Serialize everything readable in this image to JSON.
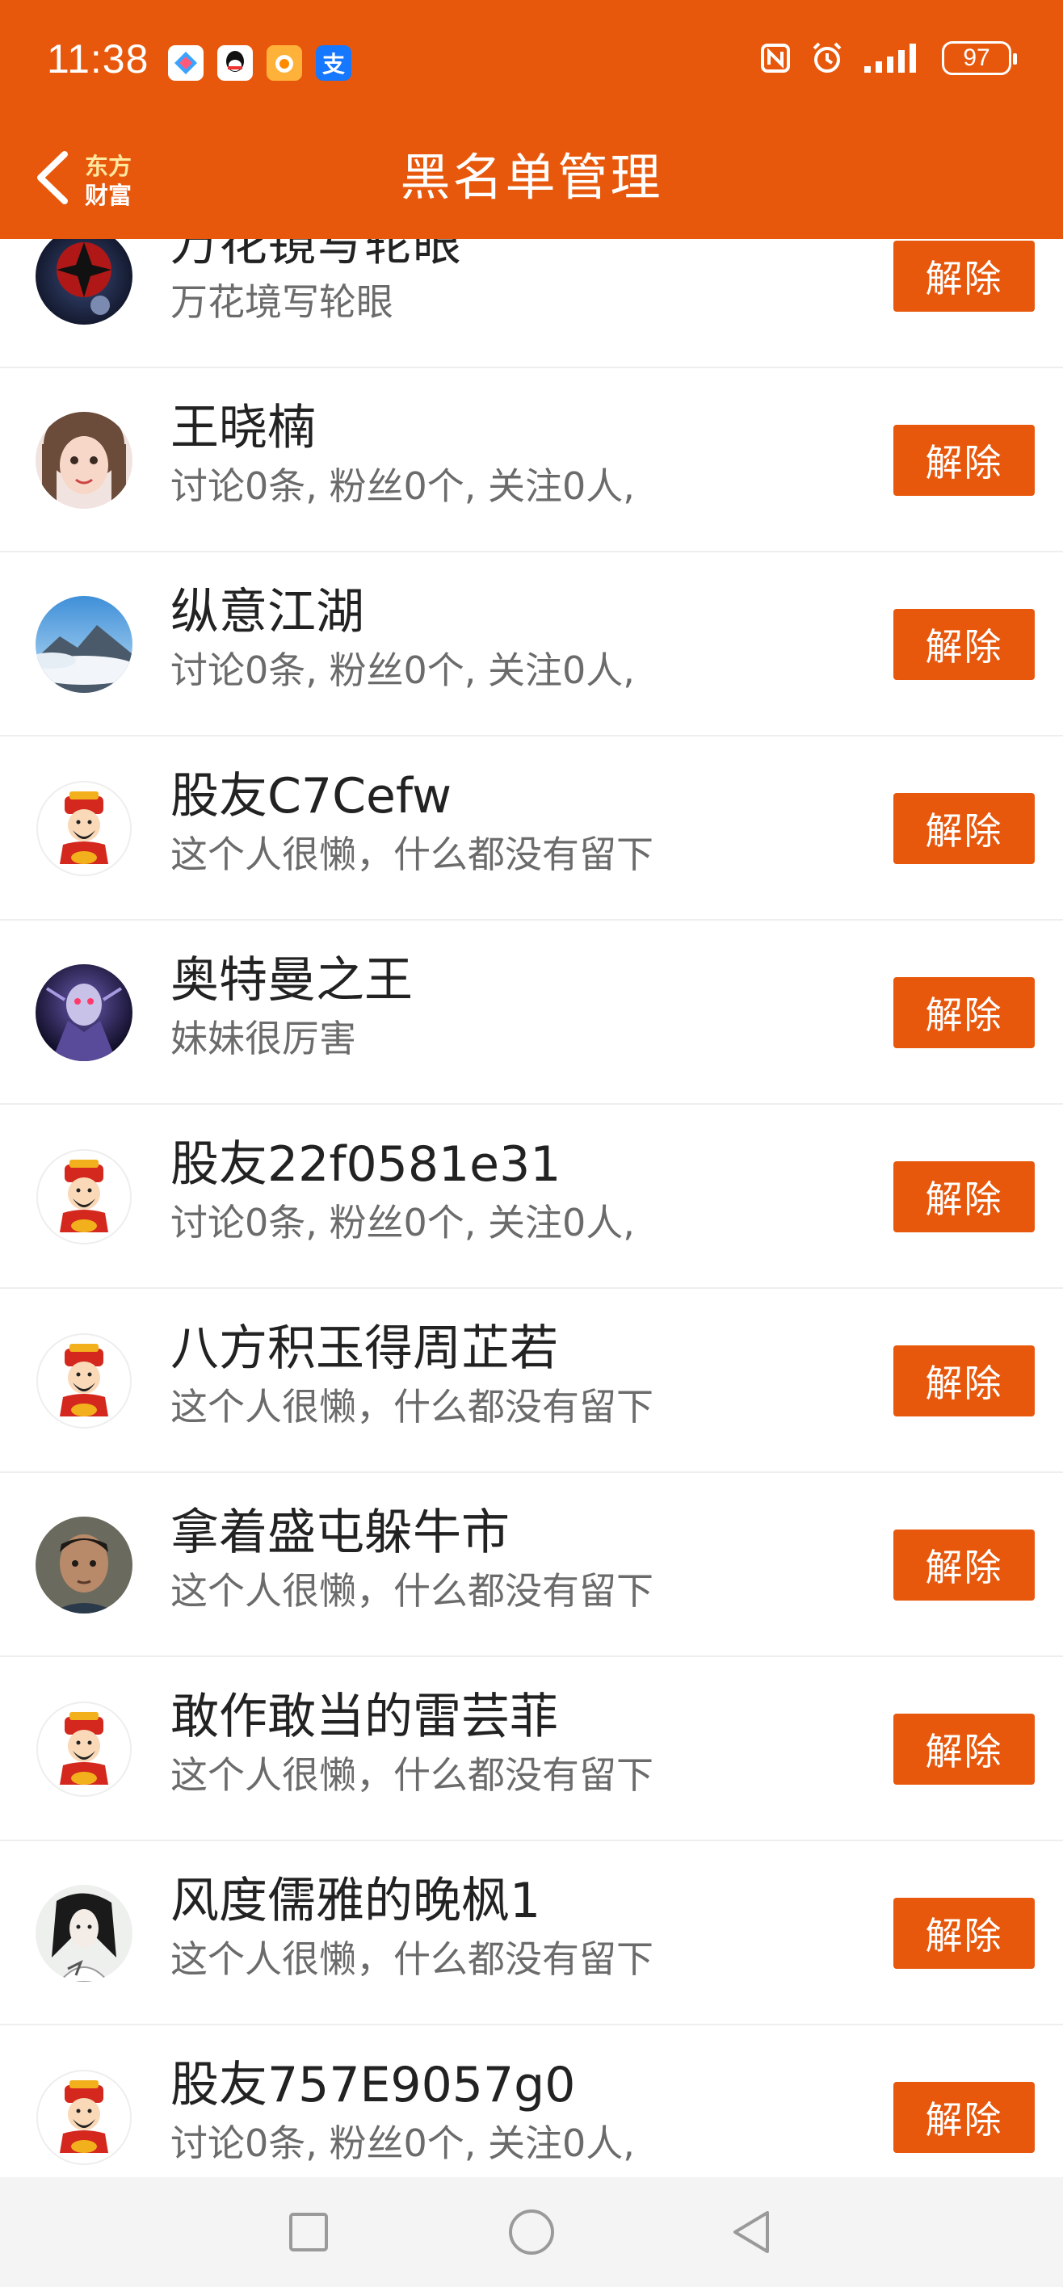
{
  "status_bar": {
    "time": "11:38",
    "battery": "97",
    "app_icons": [
      "app-icon-1",
      "qq-icon",
      "app-icon-3",
      "alipay-icon"
    ],
    "alipay_glyph": "支"
  },
  "header": {
    "title": "黑名单管理",
    "logo_line1": "东方",
    "logo_line2": "财富",
    "back_icon": "chevron-left-icon"
  },
  "colors": {
    "brand": "#e8580c",
    "name_text": "#222222",
    "desc_text": "#6b6b6b"
  },
  "blacklist": {
    "items": [
      {
        "name": "万花镜写轮眼",
        "desc": "万花境写轮眼",
        "button": "解除",
        "avatar": "sharingan-avatar"
      },
      {
        "name": "王晓楠",
        "desc": "讨论0条, 粉丝0个, 关注0人,",
        "button": "解除",
        "avatar": "girl-photo-avatar"
      },
      {
        "name": "纵意江湖",
        "desc": "讨论0条, 粉丝0个, 关注0人,",
        "button": "解除",
        "avatar": "mountain-avatar"
      },
      {
        "name": "股友C7Cefw",
        "desc": "这个人很懒，什么都没有留下",
        "button": "解除",
        "avatar": "fortune-god-avatar"
      },
      {
        "name": "奥特曼之王",
        "desc": "妹妹很厉害",
        "button": "解除",
        "avatar": "dark-art-avatar"
      },
      {
        "name": "股友22f0581e31",
        "desc": "讨论0条, 粉丝0个, 关注0人,",
        "button": "解除",
        "avatar": "fortune-god-avatar"
      },
      {
        "name": "八方积玉得周芷若",
        "desc": "这个人很懒，什么都没有留下",
        "button": "解除",
        "avatar": "fortune-god-avatar"
      },
      {
        "name": "拿着盛屯躲牛市",
        "desc": "这个人很懒，什么都没有留下",
        "button": "解除",
        "avatar": "boy-photo-avatar"
      },
      {
        "name": "敢作敢当的雷芸菲",
        "desc": "这个人很懒，什么都没有留下",
        "button": "解除",
        "avatar": "fortune-god-avatar"
      },
      {
        "name": "风度儒雅的晚枫1",
        "desc": "这个人很懒，什么都没有留下",
        "button": "解除",
        "avatar": "ink-portrait-avatar"
      },
      {
        "name": "股友757E9057g0",
        "desc": "讨论0条, 粉丝0个, 关注0人,",
        "button": "解除",
        "avatar": "fortune-god-avatar"
      }
    ]
  },
  "system_nav": [
    "recents-square-icon",
    "home-circle-icon",
    "back-triangle-icon"
  ]
}
